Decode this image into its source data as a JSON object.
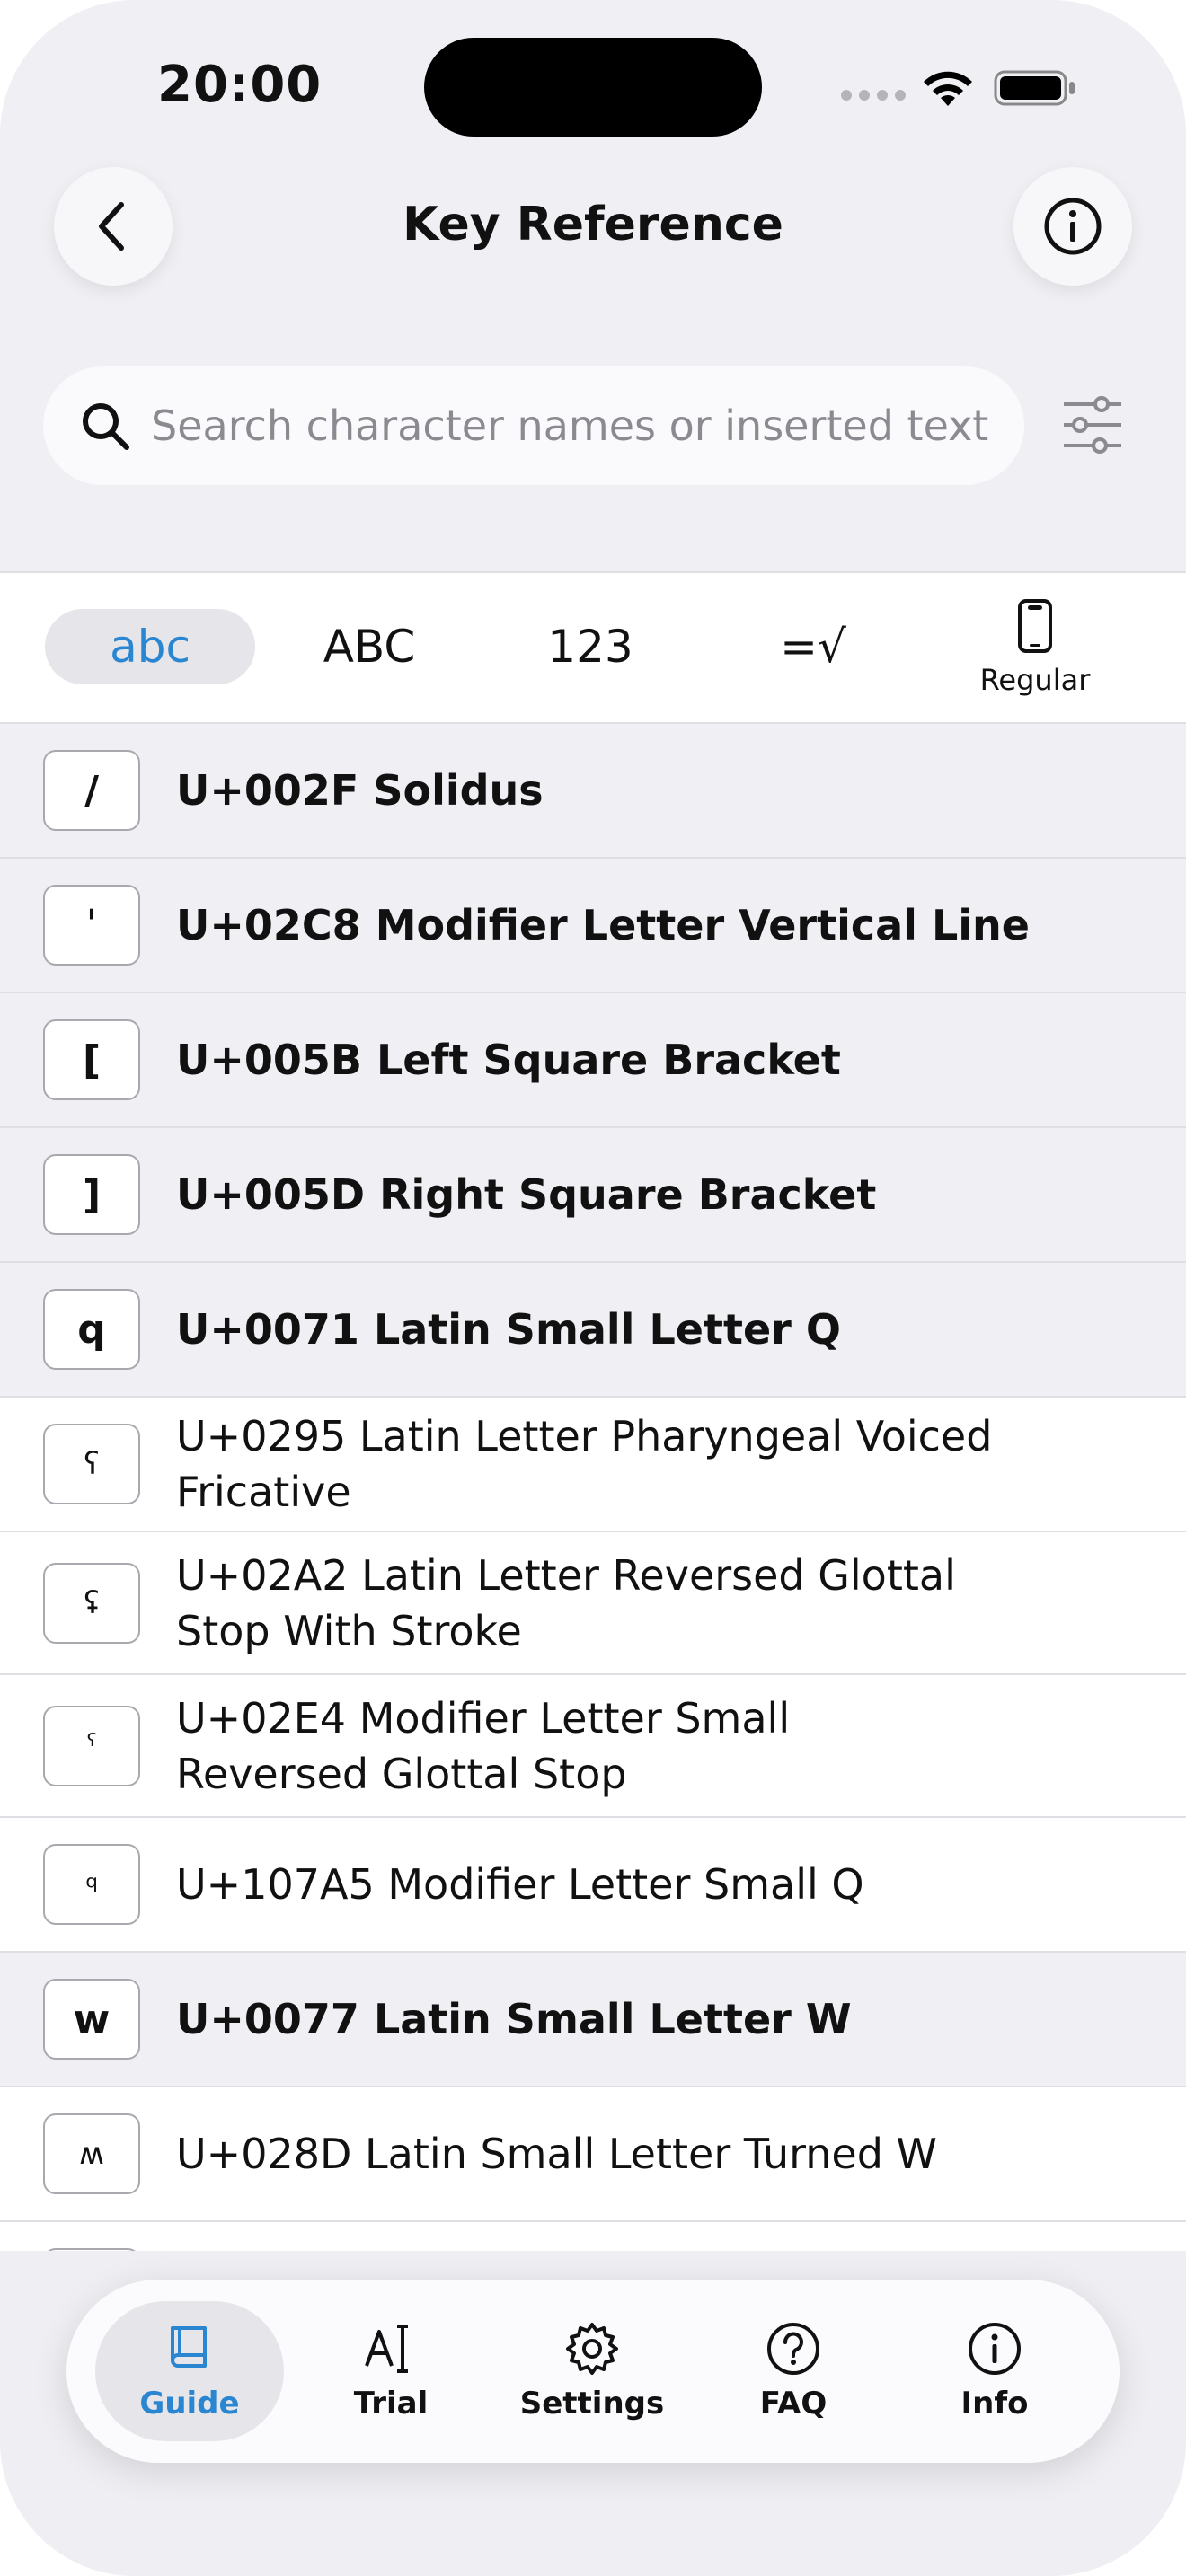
{
  "status_bar": {
    "time": "20:00"
  },
  "nav": {
    "title": "Key Reference"
  },
  "search": {
    "placeholder": "Search character names or inserted text"
  },
  "segments": [
    {
      "label": "abc",
      "active": true
    },
    {
      "label": "ABC",
      "active": false
    },
    {
      "label": "123",
      "active": false
    },
    {
      "label": "=√",
      "active": false
    },
    {
      "label": "Regular",
      "icon": "phone-icon",
      "active": false
    }
  ],
  "rows": [
    {
      "glyph": "/",
      "label": "U+002F Solidus",
      "bold": true
    },
    {
      "glyph": "ˈ",
      "label": "U+02C8 Modifier Letter Vertical Line",
      "bold": true
    },
    {
      "glyph": "[",
      "label": "U+005B Left Square Bracket",
      "bold": true
    },
    {
      "glyph": "]",
      "label": "U+005D Right Square Bracket",
      "bold": true
    },
    {
      "glyph": "q",
      "label": "U+0071 Latin Small Letter Q",
      "bold": true
    },
    {
      "glyph": "ʕ",
      "label": "U+0295 Latin Letter Pharyngeal Voiced Fricative",
      "bold": false
    },
    {
      "glyph": "ʢ",
      "label": "U+02A2 Latin Letter Reversed Glottal Stop With Stroke",
      "bold": false
    },
    {
      "glyph": "ˤ",
      "label": "U+02E4 Modifier Letter Small Reversed Glottal Stop",
      "bold": false
    },
    {
      "glyph": "𐞥",
      "label": "U+107A5 Modifier Letter Small Q",
      "bold": false
    },
    {
      "glyph": "w",
      "label": "U+0077 Latin Small Letter W",
      "bold": true
    },
    {
      "glyph": "ʍ",
      "label": "U+028D Latin Small Letter Turned W",
      "bold": false
    },
    {
      "glyph": "",
      "label": "",
      "bold": false
    }
  ],
  "tabs": [
    {
      "label": "Guide",
      "icon": "book-icon",
      "active": true
    },
    {
      "label": "Trial",
      "icon": "text-cursor-icon",
      "active": false
    },
    {
      "label": "Settings",
      "icon": "gear-icon",
      "active": false
    },
    {
      "label": "FAQ",
      "icon": "question-icon",
      "active": false
    },
    {
      "label": "Info",
      "icon": "info-icon",
      "active": false
    }
  ],
  "colors": {
    "accent": "#2a86d1",
    "background": "#efeff4"
  }
}
